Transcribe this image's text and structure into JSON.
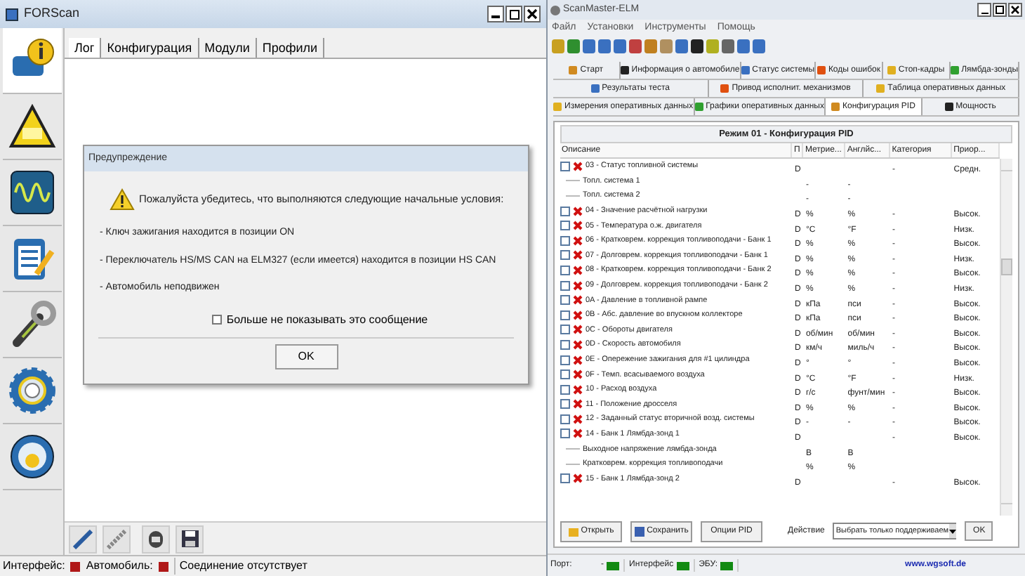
{
  "forscan": {
    "title": "FORScan",
    "sidebar": [
      {
        "selected": true
      },
      {
        "selected": false
      },
      {
        "selected": false
      },
      {
        "selected": false
      },
      {
        "selected": false
      },
      {
        "selected": false
      },
      {
        "selected": false
      }
    ],
    "tabs": [
      {
        "label": "Лог",
        "selected": true
      },
      {
        "label": "Конфигурация",
        "selected": false
      },
      {
        "label": "Модули",
        "selected": false
      },
      {
        "label": "Профили",
        "selected": false
      }
    ],
    "dialog": {
      "title": "Предупреждение",
      "heading": "Пожалуйста убедитесь, что выполняются следующие начальные условия:",
      "conditions": [
        "- Ключ зажигания находится в позиции ON",
        "- Переключатель HS/MS CAN на ELM327 (если имеется) находится в позиции HS CAN",
        "- Автомобиль неподвижен"
      ],
      "checkbox": {
        "label": "Больше не показывать это сообщение",
        "checked": false
      },
      "ok": "OK"
    },
    "status_bar": [
      {
        "label": "Интерфейс:",
        "color": "#b01818"
      },
      {
        "label": "Автомобиль:",
        "color": "#b01818"
      }
    ],
    "connection": "Соединение отсутствует"
  },
  "scanmaster": {
    "title": "ScanMaster-ELM",
    "menu": [
      "Файл",
      "Установки",
      "Инструменты",
      "Помощь"
    ],
    "tab_rows": [
      [
        {
          "label": "Старт",
          "selected": false
        },
        {
          "label": "Информация о автомобиле",
          "selected": false
        },
        {
          "label": "Статус системы",
          "selected": false
        },
        {
          "label": "Коды ошибок",
          "selected": false
        },
        {
          "label": "Стоп-кадры",
          "selected": false
        },
        {
          "label": "Лямбда-зонды",
          "selected": false
        }
      ],
      [
        {
          "label": "Результаты теста",
          "selected": false
        },
        {
          "label": "Привод исполнит. механизмов",
          "selected": false
        },
        {
          "label": "Таблица оперативных данных",
          "selected": false
        }
      ],
      [
        {
          "label": "Измерения оперативных данных",
          "selected": false
        },
        {
          "label": "Графики оперативных данных",
          "selected": false
        },
        {
          "label": "Конфигурация PID",
          "selected": true
        },
        {
          "label": "Мощность",
          "selected": false
        }
      ]
    ],
    "panel_title": "Режим 01 - Конфигурация PID",
    "columns": [
      "Описание",
      "П",
      "Метрие...",
      "Англйс...",
      "Категория",
      "Приор..."
    ],
    "rows": [
      {
        "kind": "pid",
        "checked": false,
        "cells": [
          "03 - Статус топливной системы",
          "D",
          "",
          "",
          "-",
          "Средн."
        ]
      },
      {
        "kind": "sub",
        "cells": [
          "Топл. система 1",
          "",
          "-",
          "-",
          "",
          ""
        ]
      },
      {
        "kind": "sub",
        "cells": [
          "Топл. система 2",
          "",
          "-",
          "-",
          "",
          ""
        ]
      },
      {
        "kind": "pid",
        "checked": false,
        "cells": [
          "04 - Значение расчётной нагрузки",
          "D",
          "%",
          "%",
          "-",
          "Высок."
        ]
      },
      {
        "kind": "pid",
        "checked": false,
        "cells": [
          "05 - Температура о.ж. двигателя",
          "D",
          "°C",
          "°F",
          "-",
          "Низк."
        ]
      },
      {
        "kind": "pid",
        "checked": false,
        "cells": [
          "06 - Кратковрем. коррекция топливоподачи - Банк 1",
          "D",
          "%",
          "%",
          "-",
          "Высок."
        ]
      },
      {
        "kind": "pid",
        "checked": false,
        "cells": [
          "07 - Долговрем. коррекция топливоподачи - Банк 1",
          "D",
          "%",
          "%",
          "-",
          "Низк."
        ]
      },
      {
        "kind": "pid",
        "checked": false,
        "cells": [
          "08 - Кратковрем. коррекция топливоподачи - Банк 2",
          "D",
          "%",
          "%",
          "-",
          "Высок."
        ]
      },
      {
        "kind": "pid",
        "checked": false,
        "cells": [
          "09 - Долговрем. коррекция топливоподачи - Банк 2",
          "D",
          "%",
          "%",
          "-",
          "Низк."
        ]
      },
      {
        "kind": "pid",
        "checked": false,
        "cells": [
          "0A - Давление в топливной рампе",
          "D",
          "кПа",
          "пси",
          "-",
          "Высок."
        ]
      },
      {
        "kind": "pid",
        "checked": false,
        "cells": [
          "0B - Абс. давление во впускном коллекторе",
          "D",
          "кПа",
          "пси",
          "-",
          "Высок."
        ]
      },
      {
        "kind": "pid",
        "checked": false,
        "cells": [
          "0C - Обороты двигателя",
          "D",
          "об/мин",
          "об/мин",
          "-",
          "Высок."
        ]
      },
      {
        "kind": "pid",
        "checked": false,
        "cells": [
          "0D - Скорость автомобиля",
          "D",
          "км/ч",
          "миль/ч",
          "-",
          "Высок."
        ]
      },
      {
        "kind": "pid",
        "checked": false,
        "cells": [
          "0E - Опережение зажигания для #1 цилиндра",
          "D",
          "°",
          "°",
          "-",
          "Высок."
        ]
      },
      {
        "kind": "pid",
        "checked": false,
        "cells": [
          "0F - Темп. всасываемого воздуха",
          "D",
          "°C",
          "°F",
          "-",
          "Низк."
        ]
      },
      {
        "kind": "pid",
        "checked": false,
        "cells": [
          "10 - Расход воздуха",
          "D",
          "г/с",
          "фунт/мин",
          "-",
          "Высок."
        ]
      },
      {
        "kind": "pid",
        "checked": false,
        "cells": [
          "11 - Положение дросселя",
          "D",
          "%",
          "%",
          "-",
          "Высок."
        ]
      },
      {
        "kind": "pid",
        "checked": false,
        "cells": [
          "12 - Заданный статус вторичной возд. системы",
          "D",
          "-",
          "-",
          "-",
          "Высок."
        ]
      },
      {
        "kind": "pid",
        "checked": false,
        "cells": [
          "14 - Банк 1 Лямбда-зонд 1",
          "D",
          "",
          "",
          "-",
          "Высок."
        ]
      },
      {
        "kind": "sub",
        "cells": [
          "Выходное напряжение лямбда-зонда",
          "",
          "В",
          "В",
          "",
          ""
        ]
      },
      {
        "kind": "sub",
        "cells": [
          "Кратковрем. коррекция топливоподачи",
          "",
          "%",
          "%",
          "",
          ""
        ]
      },
      {
        "kind": "pid",
        "checked": false,
        "cells": [
          "15 - Банк 1 Лямбда-зонд 2",
          "D",
          "",
          "",
          "-",
          "Высок."
        ]
      }
    ],
    "buttons": [
      "Открыть",
      "Сохранить",
      "Опции PID"
    ],
    "action_label": "Действие",
    "action_value": "Выбрать только поддерживаем",
    "ok": "OK",
    "status_bar": [
      {
        "label": "Порт:",
        "value": "-",
        "color": "#128a12"
      },
      {
        "label": "Интерфейс",
        "color": "#128a12"
      },
      {
        "label": "ЭБУ:",
        "color": "#128a12"
      }
    ],
    "website": "www.wgsoft.de"
  }
}
